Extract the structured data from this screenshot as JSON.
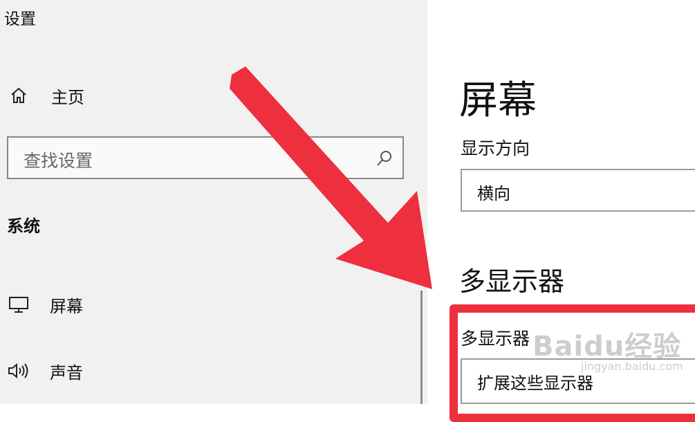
{
  "app": {
    "title": "设置"
  },
  "sidebar": {
    "home": {
      "label": "主页",
      "icon": "home-icon"
    },
    "search": {
      "placeholder": "查找设置",
      "icon": "search-icon"
    },
    "group_title": "系统",
    "items": [
      {
        "label": "屏幕",
        "icon": "monitor-icon"
      },
      {
        "label": "声音",
        "icon": "speaker-icon"
      }
    ]
  },
  "main": {
    "title": "屏幕",
    "orientation": {
      "label": "显示方向",
      "value": "横向"
    },
    "multi_display": {
      "section_title": "多显示器",
      "label": "多显示器",
      "value": "扩展这些显示器"
    }
  },
  "annotation": {
    "arrow_color": "#ee2f3d"
  },
  "watermark": {
    "brand": "Baidu经验",
    "url": "jingyan.baidu.com"
  }
}
